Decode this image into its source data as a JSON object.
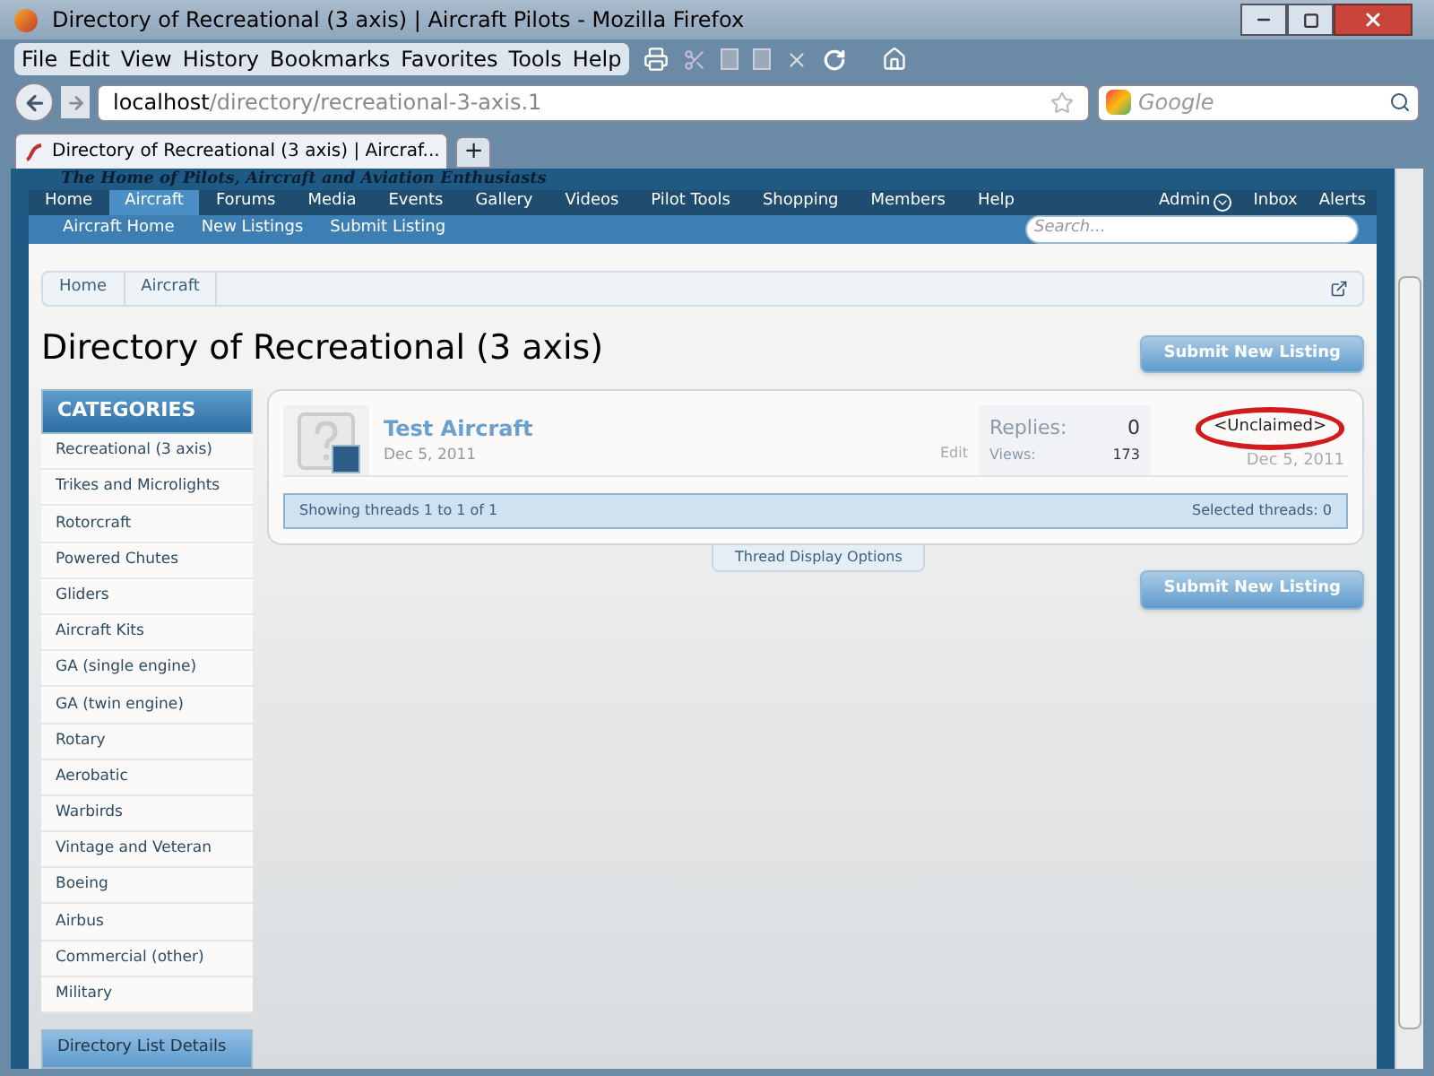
{
  "window": {
    "title": "Directory of Recreational (3 axis) | Aircraft Pilots - Mozilla Firefox"
  },
  "menu": [
    "File",
    "Edit",
    "View",
    "History",
    "Bookmarks",
    "Favorites",
    "Tools",
    "Help"
  ],
  "address": {
    "host": "localhost",
    "path": "/directory/recreational-3-axis.1"
  },
  "search": {
    "placeholder": "Google"
  },
  "tabs": [
    {
      "label": "Directory of Recreational (3 axis) | Aircraf...",
      "selected": true
    }
  ],
  "new_tab": "+",
  "site": {
    "tagline": "The Home of Pilots, Aircraft and Aviation Enthusiasts",
    "nav": [
      {
        "label": "Home",
        "selected": false
      },
      {
        "label": "Aircraft",
        "selected": true
      },
      {
        "label": "Forums",
        "selected": false
      },
      {
        "label": "Media",
        "selected": false
      },
      {
        "label": "Events",
        "selected": false
      },
      {
        "label": "Gallery",
        "selected": false
      },
      {
        "label": "Videos",
        "selected": false
      },
      {
        "label": "Pilot Tools",
        "selected": false
      },
      {
        "label": "Shopping",
        "selected": false
      },
      {
        "label": "Members",
        "selected": false
      },
      {
        "label": "Help",
        "selected": false
      }
    ],
    "user_nav": [
      "Admin",
      "Inbox",
      "Alerts"
    ],
    "sub_nav": [
      "Aircraft Home",
      "New Listings",
      "Submit Listing"
    ],
    "search_placeholder": "Search..."
  },
  "breadcrumb": [
    "Home",
    "Aircraft"
  ],
  "page_title": "Directory of Recreational (3 axis)",
  "submit_button": "Submit New Listing",
  "categories": {
    "title": "CATEGORIES",
    "items": [
      "Recreational (3 axis)",
      "Trikes and Microlights",
      "Rotorcraft",
      "Powered Chutes",
      "Gliders",
      "Aircraft Kits",
      "GA (single engine)",
      "GA (twin engine)",
      "Rotary",
      "Aerobatic",
      "Warbirds",
      "Vintage and Veteran",
      "Boeing",
      "Airbus",
      "Commercial (other)",
      "Military"
    ]
  },
  "details_title": "Directory List Details",
  "threads": [
    {
      "title": "Test Aircraft",
      "date": "Dec 5, 2011",
      "edit": "Edit",
      "replies_label": "Replies:",
      "replies": "0",
      "views_label": "Views:",
      "views": "173",
      "last_poster": "<Unclaimed>",
      "last_date": "Dec 5, 2011",
      "circled": true
    }
  ],
  "showing": "Showing threads 1 to 1 of 1",
  "selected_threads": "Selected threads: 0",
  "display_options": "Thread Display Options",
  "submit_button_bottom": "Submit New Listing"
}
